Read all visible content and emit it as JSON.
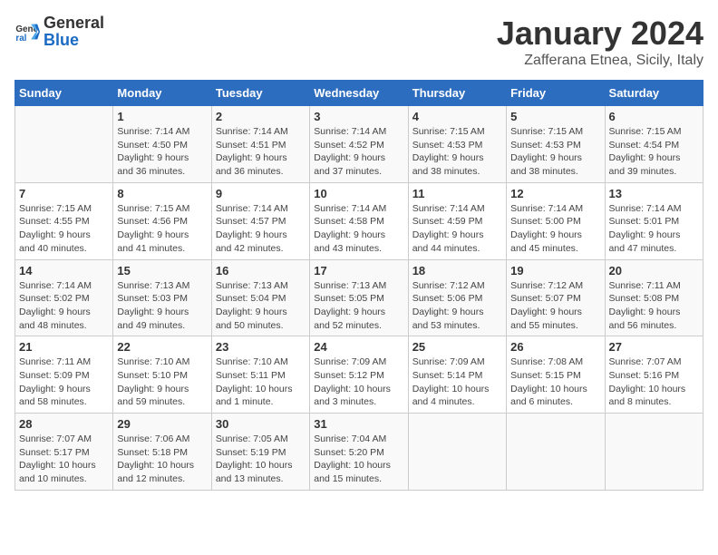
{
  "logo": {
    "general": "General",
    "blue": "Blue"
  },
  "title": "January 2024",
  "subtitle": "Zafferana Etnea, Sicily, Italy",
  "days_of_week": [
    "Sunday",
    "Monday",
    "Tuesday",
    "Wednesday",
    "Thursday",
    "Friday",
    "Saturday"
  ],
  "weeks": [
    [
      {
        "day": "",
        "info": ""
      },
      {
        "day": "1",
        "info": "Sunrise: 7:14 AM\nSunset: 4:50 PM\nDaylight: 9 hours\nand 36 minutes."
      },
      {
        "day": "2",
        "info": "Sunrise: 7:14 AM\nSunset: 4:51 PM\nDaylight: 9 hours\nand 36 minutes."
      },
      {
        "day": "3",
        "info": "Sunrise: 7:14 AM\nSunset: 4:52 PM\nDaylight: 9 hours\nand 37 minutes."
      },
      {
        "day": "4",
        "info": "Sunrise: 7:15 AM\nSunset: 4:53 PM\nDaylight: 9 hours\nand 38 minutes."
      },
      {
        "day": "5",
        "info": "Sunrise: 7:15 AM\nSunset: 4:53 PM\nDaylight: 9 hours\nand 38 minutes."
      },
      {
        "day": "6",
        "info": "Sunrise: 7:15 AM\nSunset: 4:54 PM\nDaylight: 9 hours\nand 39 minutes."
      }
    ],
    [
      {
        "day": "7",
        "info": "Sunrise: 7:15 AM\nSunset: 4:55 PM\nDaylight: 9 hours\nand 40 minutes."
      },
      {
        "day": "8",
        "info": "Sunrise: 7:15 AM\nSunset: 4:56 PM\nDaylight: 9 hours\nand 41 minutes."
      },
      {
        "day": "9",
        "info": "Sunrise: 7:14 AM\nSunset: 4:57 PM\nDaylight: 9 hours\nand 42 minutes."
      },
      {
        "day": "10",
        "info": "Sunrise: 7:14 AM\nSunset: 4:58 PM\nDaylight: 9 hours\nand 43 minutes."
      },
      {
        "day": "11",
        "info": "Sunrise: 7:14 AM\nSunset: 4:59 PM\nDaylight: 9 hours\nand 44 minutes."
      },
      {
        "day": "12",
        "info": "Sunrise: 7:14 AM\nSunset: 5:00 PM\nDaylight: 9 hours\nand 45 minutes."
      },
      {
        "day": "13",
        "info": "Sunrise: 7:14 AM\nSunset: 5:01 PM\nDaylight: 9 hours\nand 47 minutes."
      }
    ],
    [
      {
        "day": "14",
        "info": "Sunrise: 7:14 AM\nSunset: 5:02 PM\nDaylight: 9 hours\nand 48 minutes."
      },
      {
        "day": "15",
        "info": "Sunrise: 7:13 AM\nSunset: 5:03 PM\nDaylight: 9 hours\nand 49 minutes."
      },
      {
        "day": "16",
        "info": "Sunrise: 7:13 AM\nSunset: 5:04 PM\nDaylight: 9 hours\nand 50 minutes."
      },
      {
        "day": "17",
        "info": "Sunrise: 7:13 AM\nSunset: 5:05 PM\nDaylight: 9 hours\nand 52 minutes."
      },
      {
        "day": "18",
        "info": "Sunrise: 7:12 AM\nSunset: 5:06 PM\nDaylight: 9 hours\nand 53 minutes."
      },
      {
        "day": "19",
        "info": "Sunrise: 7:12 AM\nSunset: 5:07 PM\nDaylight: 9 hours\nand 55 minutes."
      },
      {
        "day": "20",
        "info": "Sunrise: 7:11 AM\nSunset: 5:08 PM\nDaylight: 9 hours\nand 56 minutes."
      }
    ],
    [
      {
        "day": "21",
        "info": "Sunrise: 7:11 AM\nSunset: 5:09 PM\nDaylight: 9 hours\nand 58 minutes."
      },
      {
        "day": "22",
        "info": "Sunrise: 7:10 AM\nSunset: 5:10 PM\nDaylight: 9 hours\nand 59 minutes."
      },
      {
        "day": "23",
        "info": "Sunrise: 7:10 AM\nSunset: 5:11 PM\nDaylight: 10 hours\nand 1 minute."
      },
      {
        "day": "24",
        "info": "Sunrise: 7:09 AM\nSunset: 5:12 PM\nDaylight: 10 hours\nand 3 minutes."
      },
      {
        "day": "25",
        "info": "Sunrise: 7:09 AM\nSunset: 5:14 PM\nDaylight: 10 hours\nand 4 minutes."
      },
      {
        "day": "26",
        "info": "Sunrise: 7:08 AM\nSunset: 5:15 PM\nDaylight: 10 hours\nand 6 minutes."
      },
      {
        "day": "27",
        "info": "Sunrise: 7:07 AM\nSunset: 5:16 PM\nDaylight: 10 hours\nand 8 minutes."
      }
    ],
    [
      {
        "day": "28",
        "info": "Sunrise: 7:07 AM\nSunset: 5:17 PM\nDaylight: 10 hours\nand 10 minutes."
      },
      {
        "day": "29",
        "info": "Sunrise: 7:06 AM\nSunset: 5:18 PM\nDaylight: 10 hours\nand 12 minutes."
      },
      {
        "day": "30",
        "info": "Sunrise: 7:05 AM\nSunset: 5:19 PM\nDaylight: 10 hours\nand 13 minutes."
      },
      {
        "day": "31",
        "info": "Sunrise: 7:04 AM\nSunset: 5:20 PM\nDaylight: 10 hours\nand 15 minutes."
      },
      {
        "day": "",
        "info": ""
      },
      {
        "day": "",
        "info": ""
      },
      {
        "day": "",
        "info": ""
      }
    ]
  ]
}
